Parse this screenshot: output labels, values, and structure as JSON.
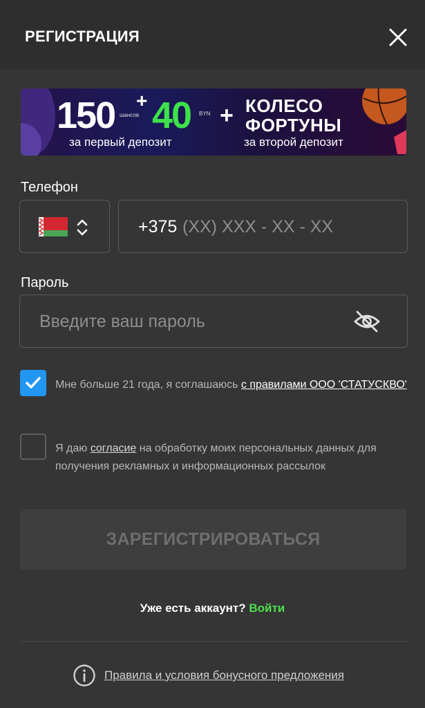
{
  "header": {
    "title": "РЕГИСТРАЦИЯ",
    "close_icon": "close-icon"
  },
  "banner": {
    "main_amount": "150",
    "main_plus": "+",
    "main_currency_label": "шансов",
    "bonus_amount": "40",
    "bonus_currency": "BYN",
    "plus": "+",
    "wheel_line1": "КОЛЕСО",
    "wheel_line2": "ФОРТУНЫ",
    "first_deposit": "за первый депозит",
    "second_deposit": "за второй депозит",
    "accent_green": "#3de24a"
  },
  "phone": {
    "label": "Телефон",
    "country_flag": "belarus-flag",
    "prefix": "+375",
    "mask": "(XX) XXX - XX - XX"
  },
  "password": {
    "label": "Пароль",
    "placeholder": "Введите ваш пароль",
    "toggle_icon": "eye-off-icon"
  },
  "consents": [
    {
      "checked": true,
      "text": "Мне больше 21 года, я соглашаюсь ",
      "link": "с правилами ООО 'СТАТУСКВО'",
      "after": ""
    },
    {
      "checked": false,
      "text": "Я даю ",
      "link": "согласие",
      "after": " на обработку моих персональных данных для получения рекламных и информационных рассылок"
    }
  ],
  "submit": {
    "label": "ЗАРЕГИСТРИРОВАТЬСЯ"
  },
  "login": {
    "question": "Уже есть аккаунт? ",
    "link": "Войти"
  },
  "footer": {
    "info_icon": "info-icon",
    "link": "Правила и условия бонусного предложения"
  },
  "colors": {
    "checkbox_checked": "#2196f3",
    "login_link": "#4ee04e",
    "background": "#353535"
  }
}
